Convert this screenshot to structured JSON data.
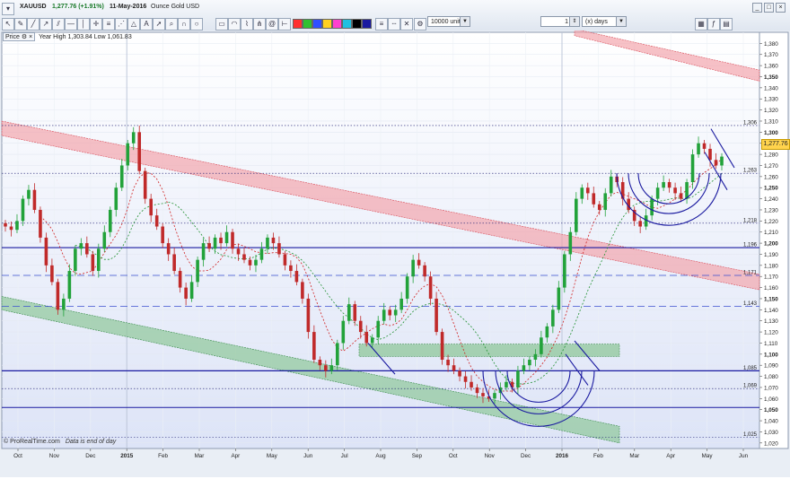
{
  "toolbar": {
    "symbol": "XAUUSD",
    "change": "1,277.76 (+1.91%)",
    "date": "11-May-2016",
    "instrument": "Ounce Gold USD",
    "units": "10000 units",
    "period_count": "1",
    "period_unit": "(x) days"
  },
  "legend": {
    "price_label": "Price",
    "year_stats": "Year High 1,303.84 Low 1,061.83"
  },
  "footer": {
    "source": "© ProRealTime.com",
    "note": "Data is end of day"
  },
  "price_tag": "1,277.76",
  "colors": {
    "up": "#22a23a",
    "down": "#c02a2a",
    "red_channel": "#f2a0a8",
    "green_channel": "#8fc79a",
    "navy": "#1a1aa0"
  },
  "chart_data": {
    "type": "candlestick",
    "y_ticks": [
      1020,
      1030,
      1040,
      1050,
      1060,
      1070,
      1080,
      1090,
      1100,
      1110,
      1120,
      1130,
      1140,
      1150,
      1160,
      1170,
      1180,
      1190,
      1200,
      1210,
      1220,
      1230,
      1240,
      1250,
      1260,
      1270,
      1280,
      1290,
      1300,
      1310,
      1320,
      1330,
      1340,
      1350,
      1360,
      1370,
      1380
    ],
    "y_tick_labels": [
      "1,020",
      "1,030",
      "1,040",
      "1,050",
      "1,060",
      "1,070",
      "1,080",
      "1,090",
      "1,100",
      "1,110",
      "1,120",
      "1,130",
      "1,140",
      "1,150",
      "1,160",
      "1,170",
      "1,180",
      "1,190",
      "1,200",
      "1,210",
      "1,220",
      "1,230",
      "1,240",
      "1,250",
      "1,260",
      "1,270",
      "1,280",
      "1,290",
      "1,300",
      "1,310",
      "1,320",
      "1,330",
      "1,340",
      "1,350",
      "1,360",
      "1,370",
      "1,380"
    ],
    "bold_ticks": [
      1050,
      1100,
      1150,
      1200,
      1250,
      1300,
      1350
    ],
    "ylim": [
      1015,
      1390
    ],
    "x_labels": [
      "Oct",
      "Nov",
      "Dec",
      "2015",
      "Feb",
      "Mar",
      "Apr",
      "May",
      "Jun",
      "Jul",
      "Aug",
      "Sep",
      "Oct",
      "Nov",
      "Dec",
      "2016",
      "Feb",
      "Mar",
      "Apr",
      "May",
      "Jun"
    ],
    "bold_x": [
      "2015",
      "2016"
    ],
    "level_lines": [
      {
        "value": 1306,
        "label": "1,306",
        "style": "dotted"
      },
      {
        "value": 1263,
        "label": "1,263",
        "style": "dotted"
      },
      {
        "value": 1218,
        "label": "1,218",
        "style": "dotted"
      },
      {
        "value": 1196,
        "label": "1,196",
        "style": "solid"
      },
      {
        "value": 1171,
        "label": "1,171",
        "style": "dashed"
      },
      {
        "value": 1143,
        "label": "1,143",
        "style": "dashed"
      },
      {
        "value": 1085,
        "label": "1,085",
        "style": "solid"
      },
      {
        "value": 1069,
        "label": "1,069",
        "style": "dotted"
      },
      {
        "value": 1025,
        "label": "1,025",
        "style": "dotted"
      }
    ],
    "closes": [
      1215,
      1212,
      1220,
      1240,
      1248,
      1230,
      1205,
      1180,
      1165,
      1140,
      1150,
      1175,
      1195,
      1200,
      1190,
      1175,
      1195,
      1210,
      1230,
      1250,
      1270,
      1290,
      1300,
      1265,
      1240,
      1225,
      1215,
      1200,
      1190,
      1175,
      1160,
      1150,
      1165,
      1185,
      1200,
      1195,
      1205,
      1200,
      1210,
      1195,
      1190,
      1185,
      1180,
      1185,
      1195,
      1205,
      1200,
      1190,
      1180,
      1175,
      1165,
      1150,
      1120,
      1095,
      1090,
      1085,
      1090,
      1110,
      1130,
      1145,
      1130,
      1120,
      1110,
      1115,
      1130,
      1140,
      1135,
      1140,
      1150,
      1170,
      1185,
      1180,
      1170,
      1150,
      1120,
      1095,
      1090,
      1085,
      1080,
      1075,
      1070,
      1065,
      1062,
      1060,
      1065,
      1070,
      1075,
      1070,
      1085,
      1090,
      1095,
      1100,
      1115,
      1125,
      1140,
      1160,
      1190,
      1210,
      1240,
      1250,
      1245,
      1235,
      1230,
      1245,
      1260,
      1255,
      1240,
      1230,
      1220,
      1215,
      1225,
      1240,
      1250,
      1255,
      1250,
      1245,
      1240,
      1255,
      1280,
      1290,
      1285,
      1275,
      1270,
      1278
    ]
  }
}
